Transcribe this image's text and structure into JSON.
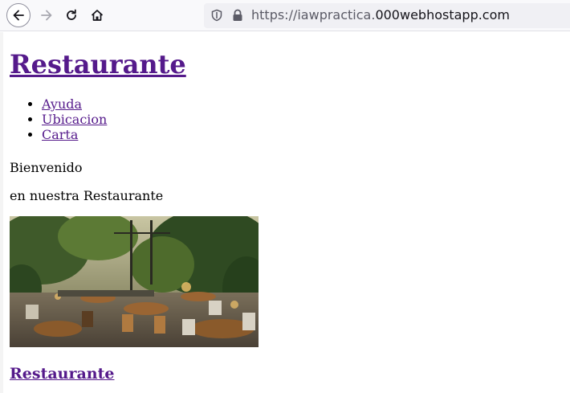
{
  "browser": {
    "url_prefix": "https://iawpractica.",
    "url_host": "000webhostapp.com"
  },
  "page": {
    "title": "Restaurante",
    "menu": [
      {
        "label": "Ayuda"
      },
      {
        "label": "Ubicacion"
      },
      {
        "label": "Carta"
      }
    ],
    "welcome": "Bienvenido",
    "tagline": "en nuestra Restaurante",
    "footer_title": "Restaurante"
  },
  "colors": {
    "link_visited": "#551a8b",
    "toolbar_bg": "#f9f9fb",
    "urlbar_bg": "#f0f0f4"
  },
  "icons": [
    "back-arrow-icon",
    "forward-arrow-icon",
    "reload-icon",
    "home-icon",
    "shield-icon",
    "lock-icon"
  ]
}
